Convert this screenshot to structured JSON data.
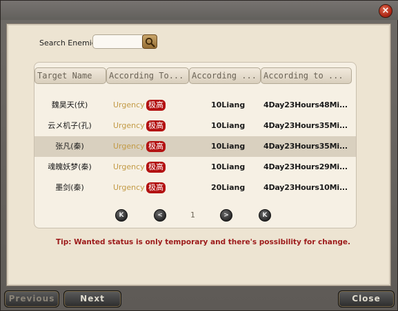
{
  "search": {
    "label": "Search Enemies",
    "value": "",
    "placeholder": ""
  },
  "columns": [
    "Target Name",
    "According To...",
    "According ...",
    "According to ..."
  ],
  "rows": [
    {
      "name": "魏昊天(伏)",
      "urgency": "Urgency",
      "stamp": "极高",
      "bounty": "10Liang",
      "time": "4Day23Hours48Mi..."
    },
    {
      "name": "云メ机子(孔)",
      "urgency": "Urgency",
      "stamp": "极高",
      "bounty": "10Liang",
      "time": "4Day23Hours35Mi..."
    },
    {
      "name": "张凡(秦)",
      "urgency": "Urgency",
      "stamp": "极高",
      "bounty": "10Liang",
      "time": "4Day23Hours35Mi..."
    },
    {
      "name": "魂魄妖梦(秦)",
      "urgency": "Urgency",
      "stamp": "极高",
      "bounty": "10Liang",
      "time": "4Day23Hours29Mi..."
    },
    {
      "name": "墨剑(秦)",
      "urgency": "Urgency",
      "stamp": "极高",
      "bounty": "20Liang",
      "time": "4Day23Hours10Mi..."
    }
  ],
  "pager": {
    "page": "1",
    "first": "K",
    "prev": "<",
    "next": ">",
    "last": "K"
  },
  "tip": "Tip: Wanted status is only temporary and there's possibility for change.",
  "buttons": {
    "previous": "Previous",
    "next": "Next",
    "close": "Close",
    "close_x": "×"
  },
  "colors": {
    "accent_red": "#b31212",
    "urgency_gold": "#c29a45",
    "tip_red": "#9c1a1a"
  }
}
